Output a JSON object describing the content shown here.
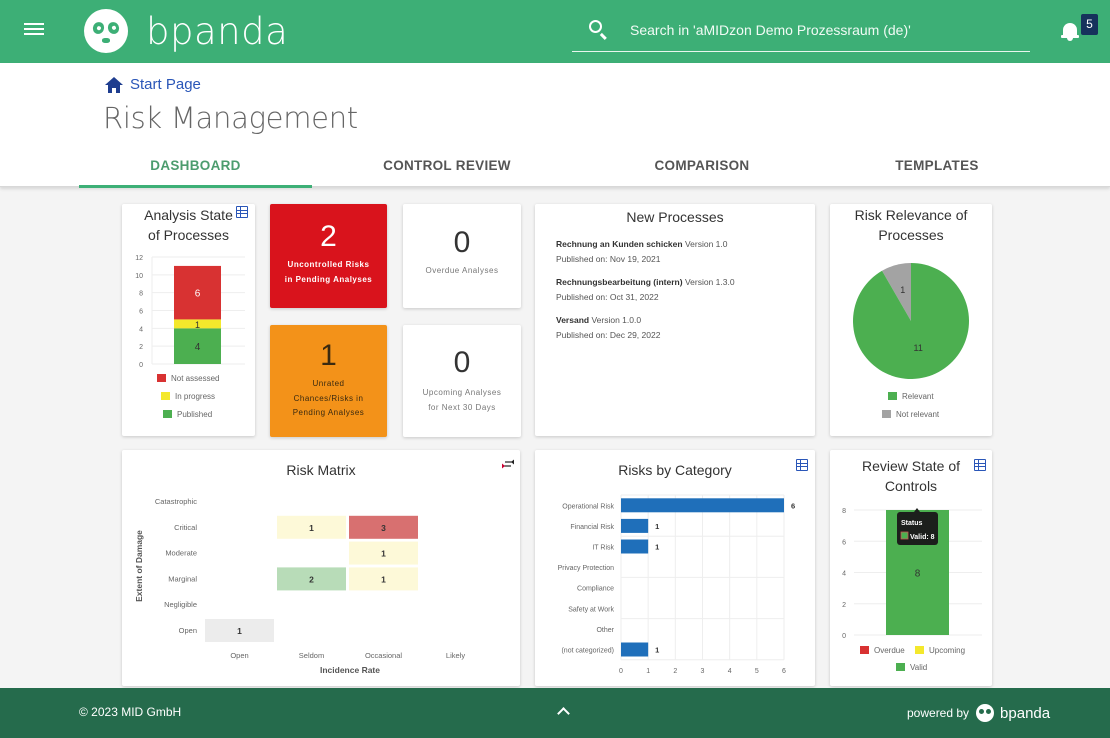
{
  "app": {
    "brand": "bpanda",
    "search_placeholder": "Search in 'aMIDzon Demo Prozessraum (de)'",
    "notification_count": "5"
  },
  "header": {
    "breadcrumb": "Start Page",
    "title": "Risk Management",
    "tabs": [
      {
        "label": "DASHBOARD",
        "active": true
      },
      {
        "label": "CONTROL REVIEW",
        "active": false
      },
      {
        "label": "COMPARISON",
        "active": false
      },
      {
        "label": "TEMPLATES",
        "active": false
      }
    ]
  },
  "kpis": {
    "uncontrolled": {
      "value": "2",
      "label_line1": "Uncontrolled Risks",
      "label_line2": "in Pending Analyses"
    },
    "overdue": {
      "value": "0",
      "label_line1": "Overdue Analyses"
    },
    "unrated": {
      "value": "1",
      "label_line1": "Unrated",
      "label_line2": "Chances/Risks in",
      "label_line3": "Pending Analyses"
    },
    "upcoming": {
      "value": "0",
      "label_line1": "Upcoming Analyses",
      "label_line2": "for Next 30 Days"
    }
  },
  "new_processes": {
    "title": "New Processes",
    "items": [
      {
        "name": "Rechnung an Kunden schicken",
        "version": "Version 1.0",
        "published": "Published on: Nov 19, 2021"
      },
      {
        "name": "Rechnungsbearbeitung (intern)",
        "version": "Version 1.3.0",
        "published": "Published on: Oct 31, 2022"
      },
      {
        "name": "Versand",
        "version": "Version 1.0.0",
        "published": "Published on: Dec 29, 2022"
      }
    ]
  },
  "colors": {
    "brand_green": "#3daf76",
    "footer_green": "#256b4c",
    "red": "#d9131c",
    "orange": "#f39219",
    "bar_blue": "#1f6fba",
    "chart_red": "#d83232",
    "chart_yellow": "#f4e82c",
    "chart_green": "#4caf50",
    "chart_gray": "#a3a3a3"
  },
  "chart_data": [
    {
      "id": "analysis_state",
      "type": "bar",
      "title_line1": "Analysis State",
      "title_line2": "of Processes",
      "stacked": true,
      "categories": [
        ""
      ],
      "series": [
        {
          "name": "Published",
          "values": [
            4
          ],
          "color": "#4caf50",
          "label_color": "#333"
        },
        {
          "name": "In progress",
          "values": [
            1
          ],
          "color": "#f4e82c",
          "label_color": "#333"
        },
        {
          "name": "Not assessed",
          "values": [
            6
          ],
          "color": "#d83232",
          "label_color": "#fff"
        }
      ],
      "legend_order": [
        "Not assessed",
        "In progress",
        "Published"
      ],
      "yticks": [
        "0",
        "2",
        "4",
        "6",
        "8",
        "10",
        "12"
      ],
      "ylim": [
        0,
        12
      ],
      "legend": "bottom",
      "grid": true
    },
    {
      "id": "risk_relevance",
      "type": "pie",
      "title_line1": "Risk Relevance of",
      "title_line2": "Processes",
      "slices": [
        {
          "name": "Not relevant",
          "value": 1,
          "color": "#a3a3a3"
        },
        {
          "name": "Relevant",
          "value": 11,
          "color": "#4caf50"
        }
      ],
      "legend_order": [
        "Relevant",
        "Not relevant"
      ],
      "legend": "bottom"
    },
    {
      "id": "risk_matrix",
      "type": "heatmap",
      "title": "Risk Matrix",
      "xlabel": "Incidence Rate",
      "ylabel": "Extent of Damage",
      "x_categories": [
        "Open",
        "Seldom",
        "Occasional",
        "Likely"
      ],
      "y_categories": [
        "Catastrophic",
        "Critical",
        "Moderate",
        "Marginal",
        "Negligible",
        "Open"
      ],
      "cells": [
        {
          "x": "Seldom",
          "y": "Critical",
          "value": 1,
          "color": "#fdf9d8"
        },
        {
          "x": "Occasional",
          "y": "Critical",
          "value": 3,
          "color": "#d87070"
        },
        {
          "x": "Occasional",
          "y": "Moderate",
          "value": 1,
          "color": "#fdf9d8"
        },
        {
          "x": "Seldom",
          "y": "Marginal",
          "value": 2,
          "color": "#b8dcb8"
        },
        {
          "x": "Occasional",
          "y": "Marginal",
          "value": 1,
          "color": "#fdf9d8"
        },
        {
          "x": "Open",
          "y": "Open",
          "value": 1,
          "color": "#ececec"
        }
      ]
    },
    {
      "id": "risks_by_category",
      "type": "bar",
      "orientation": "horizontal",
      "title": "Risks by Category",
      "categories": [
        "Operational Risk",
        "Financial Risk",
        "IT Risk",
        "Privacy Protection",
        "Compliance",
        "Safety at Work",
        "Other",
        "(not categorized)"
      ],
      "values": [
        6,
        1,
        1,
        0,
        0,
        0,
        0,
        1
      ],
      "color": "#1f6fba",
      "xticks": [
        "0",
        "1",
        "2",
        "3",
        "4",
        "5",
        "6"
      ],
      "xlim": [
        0,
        6
      ],
      "grid": true
    },
    {
      "id": "review_state",
      "type": "bar",
      "title_line1": "Review State of",
      "title_line2": "Controls",
      "stacked": true,
      "categories": [
        ""
      ],
      "series": [
        {
          "name": "Overdue",
          "values": [
            0
          ],
          "color": "#d83232"
        },
        {
          "name": "Upcoming",
          "values": [
            0
          ],
          "color": "#f4e82c"
        },
        {
          "name": "Valid",
          "values": [
            8
          ],
          "color": "#4caf50"
        }
      ],
      "yticks": [
        "0",
        "2",
        "4",
        "6",
        "8"
      ],
      "ylim": [
        0,
        8
      ],
      "tooltip": {
        "title": "Status",
        "text": "Valid: 8"
      },
      "legend": "bottom",
      "grid": true
    }
  ],
  "footer": {
    "copyright": "© 2023 MID GmbH",
    "powered_by": "powered by",
    "brand": "bpanda"
  }
}
